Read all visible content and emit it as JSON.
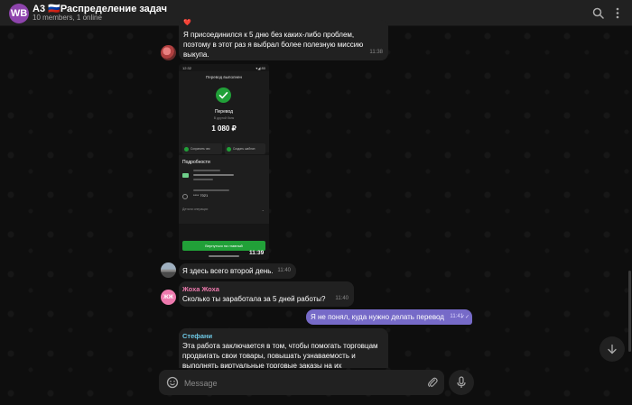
{
  "header": {
    "avatar_initials": "WB",
    "avatar_color": "#8e44ad",
    "title": "A3 🇷🇺Распределение задач",
    "subtitle": "10 members, 1 online",
    "icons": [
      "search-icon",
      "more-vertical-icon"
    ]
  },
  "messages": [
    {
      "text": "Я присоединился к 5 дню без каких-либо проблем, поэтому в этот раз я выбрал более полезную миссию выкупа.",
      "time": "11:38",
      "reaction": "❤️"
    },
    {
      "type": "image",
      "time": "11:39",
      "screenshot": {
        "status_time": "12:32",
        "status_right": "▾◢ 80",
        "title": "Перевод выполнен",
        "transfer_label": "Перевод",
        "bank_label": "В другой банк",
        "amount": "1 080 ₽",
        "action_1": "Сохранить чек",
        "action_2": "Создать шаблон",
        "details_title": "Подробности",
        "card_masked": "**** 7021",
        "operations_label": "Детали операции",
        "pay_button": "Вернуться на главный"
      }
    },
    {
      "text": "Я здесь всего второй день.",
      "time": "11:40"
    },
    {
      "sender": "Жоха Жоха",
      "sender_color": "#ee7aae",
      "avatar_initials": "ЖЖ",
      "text": "Сколько ты заработала  за 5 дней работы?",
      "time": "11:40"
    },
    {
      "outgoing": true,
      "text": "Я не понял, куда нужно делать перевод",
      "time": "11:41",
      "bubble_color": "#766ac8"
    },
    {
      "sender": "Стефани",
      "sender_color": "#6ec9e6",
      "text": "Эта работа заключается в том, чтобы помогать торговцам продвигать свои товары, повышать узнаваемость и выполнять виртуальные торговые заказы на их"
    }
  ],
  "composer": {
    "placeholder": "Message"
  }
}
